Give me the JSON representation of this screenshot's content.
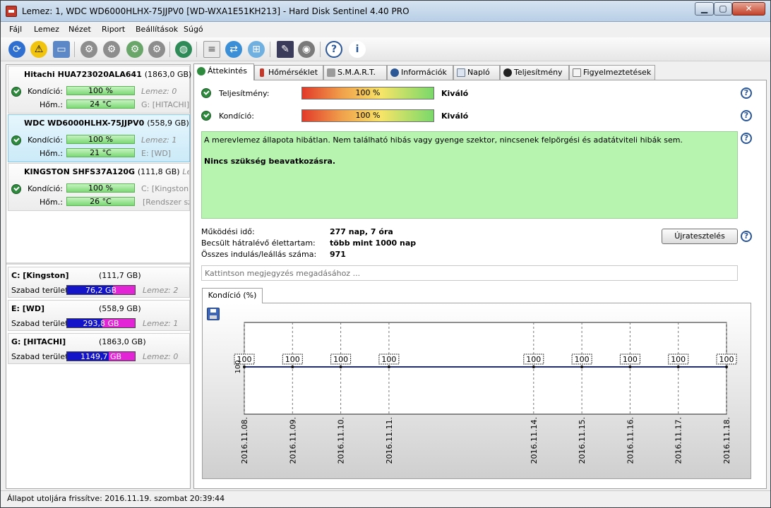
{
  "window": {
    "title": "Lemez: 1, WDC WD6000HLHX-75JJPV0 [WD-WXA1E51KH213]  -  Hard Disk Sentinel 4.40 PRO"
  },
  "menu": [
    "Fájl",
    "Lemez",
    "Nézet",
    "Riport",
    "Beállítások",
    "Súgó"
  ],
  "toolbar": {
    "icons": [
      "refresh-icon",
      "warning-icon",
      "disk-icon",
      "test-icon",
      "test-icon",
      "test-icon",
      "test-icon",
      "globe-icon",
      "document-icon",
      "sync-icon",
      "network-icon",
      "graph-icon",
      "speaker-icon",
      "help-icon",
      "info-icon"
    ]
  },
  "disks": [
    {
      "name": "Hitachi HUA723020ALA641",
      "size": "(1863,0 GB)",
      "condition_label": "Kondíció:",
      "condition": "100 %",
      "temp_label": "Hőm.:",
      "temp": "24 °C",
      "extra1": "Lemez: 0",
      "extra2": "G: [HITACHI]"
    },
    {
      "name": "WDC WD6000HLHX-75JJPV0",
      "size": "(558,9 GB)",
      "condition_label": "Kondíció:",
      "condition": "100 %",
      "temp_label": "Hőm.:",
      "temp": "21 °C",
      "extra1": "Lemez: 1",
      "extra2": "E: [WD]"
    },
    {
      "name": "KINGSTON SHFS37A120G",
      "size": "(111,8 GB)",
      "condition_label": "Kondíció:",
      "condition": "100 %",
      "temp_label": "Hőm.:",
      "temp": "26 °C",
      "extra1": "Lemez",
      "extra1_b": "C: [Kingston],",
      "extra2": "[Rendszer szá"
    }
  ],
  "volumes": [
    {
      "name": "C: [Kingston]",
      "size": "(111,7 GB)",
      "free_label": "Szabad terület",
      "free": "76,2 GB",
      "free_fraction": 0.682,
      "disk": "Lemez: 2"
    },
    {
      "name": "E: [WD]",
      "size": "(558,9 GB)",
      "free_label": "Szabad terület",
      "free": "293,8 GB",
      "free_fraction": 0.526,
      "disk": "Lemez: 1"
    },
    {
      "name": "G: [HITACHI]",
      "size": "(1863,0 GB)",
      "free_label": "Szabad terület",
      "free": "1149,7 GB",
      "free_fraction": 0.617,
      "disk": "Lemez: 0"
    }
  ],
  "tabs": [
    {
      "label": "Áttekintés",
      "icon": "check-icon"
    },
    {
      "label": "Hőmérséklet",
      "icon": "thermometer-icon"
    },
    {
      "label": "S.M.A.R.T.",
      "icon": "smart-icon"
    },
    {
      "label": "Információk",
      "icon": "info-icon"
    },
    {
      "label": "Napló",
      "icon": "log-icon"
    },
    {
      "label": "Teljesítmény",
      "icon": "gauge-icon"
    },
    {
      "label": "Figyelmeztetések",
      "icon": "alerts-icon"
    }
  ],
  "overview": {
    "performance_label": "Teljesítmény:",
    "performance_value": "100 %",
    "performance_fraction": 1.0,
    "performance_verdict": "Kiváló",
    "condition_label": "Kondíció:",
    "condition_value": "100 %",
    "condition_fraction": 1.0,
    "condition_verdict": "Kiváló",
    "status_text": "A merevlemez állapota hibátlan. Nem található hibás vagy gyenge szektor, nincsenek felpörgési és adatátviteli hibák sem.",
    "status_action": "Nincs szükség beavatkozásra.",
    "uptime_label": "Működési idő:",
    "uptime_value": "277 nap, 7 óra",
    "remaining_label": "Becsült hátralévő élettartam:",
    "remaining_value": "több mint 1000 nap",
    "startstop_label": "Összes indulás/leállás száma:",
    "startstop_value": "971",
    "retest_button": "Újratesztelés",
    "note_placeholder": "Kattintson megjegyzés megadásához ...",
    "chart_tab": "Kondíció  (%)"
  },
  "chart_data": {
    "type": "line",
    "x": [
      "2016.11.08.",
      "2016.11.09.",
      "2016.11.10.",
      "2016.11.11.",
      "2016.11.14.",
      "2016.11.15.",
      "2016.11.16.",
      "2016.11.17.",
      "2016.11.18."
    ],
    "x_day_index": [
      8,
      9,
      10,
      11,
      14,
      15,
      16,
      17,
      18
    ],
    "values": [
      100,
      100,
      100,
      100,
      100,
      100,
      100,
      100,
      100
    ],
    "data_labels": [
      "100",
      "100",
      "100",
      "100",
      "100",
      "100",
      "100",
      "100",
      "100"
    ],
    "y_tick": "100",
    "grid": true,
    "series_color": "#1c2a8c"
  },
  "statusbar": {
    "text": "Állapot utoljára frissítve: 2016.11.19. szombat 20:39:44"
  }
}
